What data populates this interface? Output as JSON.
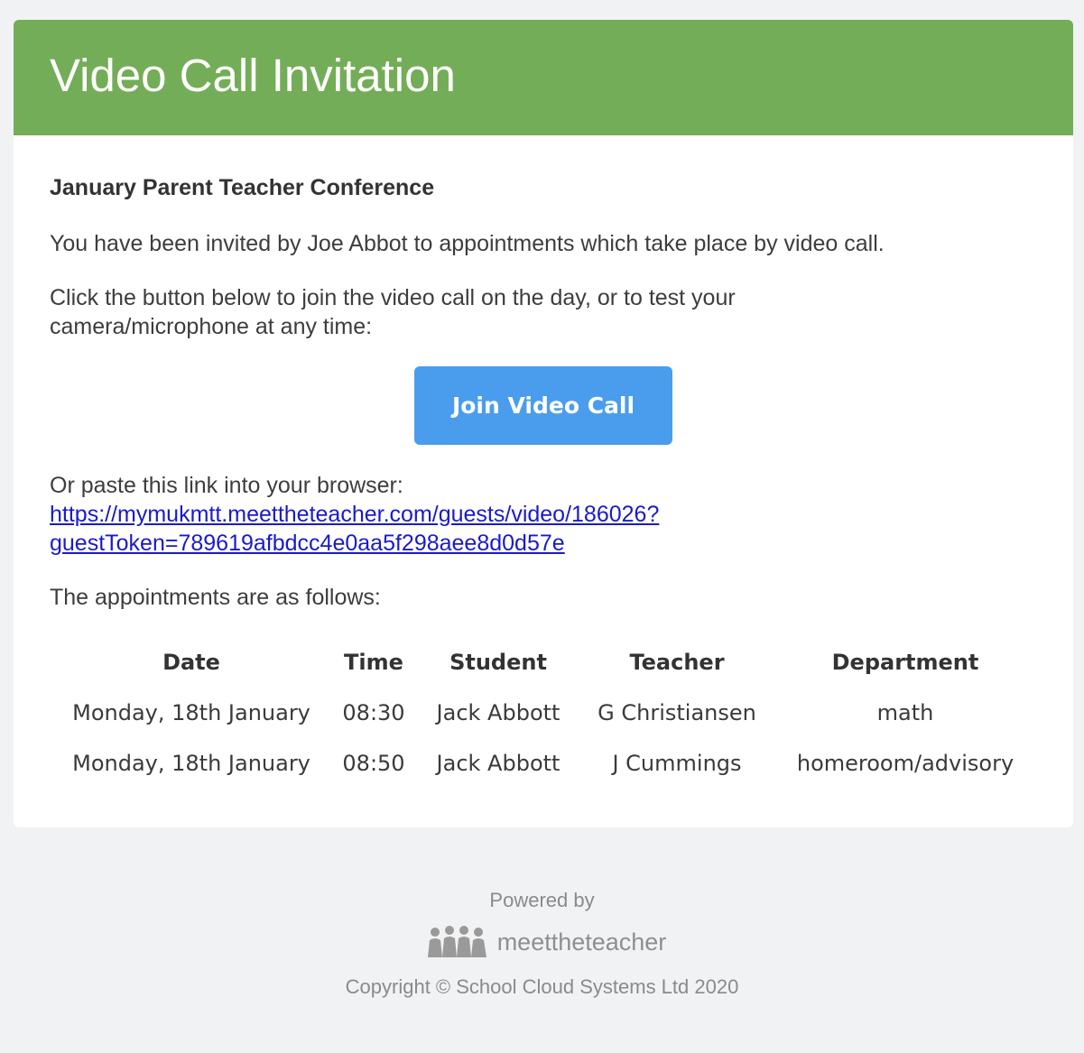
{
  "header": {
    "title": "Video Call Invitation"
  },
  "body": {
    "event_title": "January Parent Teacher Conference",
    "invite_text": "You have been invited by Joe Abbot to appointments which take place by video call.",
    "instruction_text": "Click the button below to join the video call on the day, or to test your camera/microphone at any time:",
    "join_button_label": "Join Video Call",
    "paste_text": "Or paste this link into your browser:",
    "link_line1": "https://mymukmtt.meettheteacher.com/guests/video/186026?",
    "link_line2": "guestToken=789619afbdcc4e0aa5f298aee8d0d57e",
    "appointments_intro": "The appointments are as follows:"
  },
  "table": {
    "headers": [
      "Date",
      "Time",
      "Student",
      "Teacher",
      "Department"
    ],
    "rows": [
      [
        "Monday, 18th January",
        "08:30",
        "Jack Abbott",
        "G Christiansen",
        "math"
      ],
      [
        "Monday, 18th January",
        "08:50",
        "Jack Abbott",
        "J Cummings",
        "homeroom/advisory"
      ]
    ]
  },
  "footer": {
    "powered_by": "Powered by",
    "brand_name": "meettheteacher",
    "brand_icon": "people-group-icon",
    "copyright": "Copyright © School Cloud Systems Ltd 2020"
  },
  "colors": {
    "header_bg": "#74ad57",
    "button_bg": "#4a9ded",
    "link": "#1a1acb",
    "page_bg": "#f1f2f4"
  }
}
